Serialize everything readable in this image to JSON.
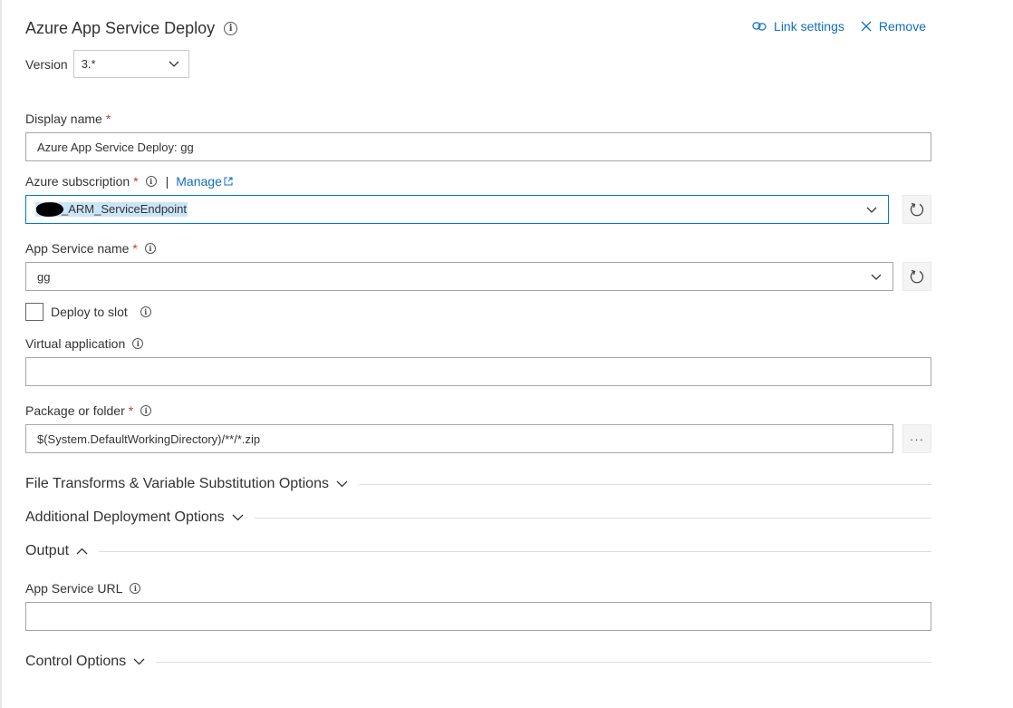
{
  "task": {
    "title": "Azure App Service Deploy",
    "version_label": "Version",
    "version_value": "3.*"
  },
  "actions": {
    "link_settings": "Link settings",
    "remove": "Remove"
  },
  "fields": {
    "display_name": {
      "label": "Display name",
      "required": "*",
      "value": "Azure App Service Deploy: gg"
    },
    "subscription": {
      "label": "Azure subscription",
      "required": "*",
      "separator": "|",
      "manage": "Manage",
      "value": "_ARM_ServiceEndpoint"
    },
    "app_service_name": {
      "label": "App Service name",
      "required": "*",
      "value": "gg"
    },
    "deploy_to_slot": {
      "label": "Deploy to slot",
      "checked": false
    },
    "virtual_application": {
      "label": "Virtual application",
      "value": ""
    },
    "package": {
      "label": "Package or folder",
      "required": "*",
      "value": "$(System.DefaultWorkingDirectory)/**/*.zip",
      "browse": "···"
    },
    "app_service_url": {
      "label": "App Service URL",
      "value": ""
    }
  },
  "sections": {
    "file_transforms": "File Transforms & Variable Substitution Options",
    "additional": "Additional Deployment Options",
    "output": "Output",
    "control": "Control Options"
  },
  "colors": {
    "link": "#106ebe",
    "required": "#d13438",
    "focus_border": "#0078d4",
    "selection": "#cce4f7"
  },
  "icons": {
    "info": "info-icon",
    "link": "link-icon",
    "close": "close-icon",
    "chevron_down": "chevron-down-icon",
    "chevron_up": "chevron-up-icon",
    "refresh": "refresh-icon",
    "external_link": "external-link-icon"
  }
}
